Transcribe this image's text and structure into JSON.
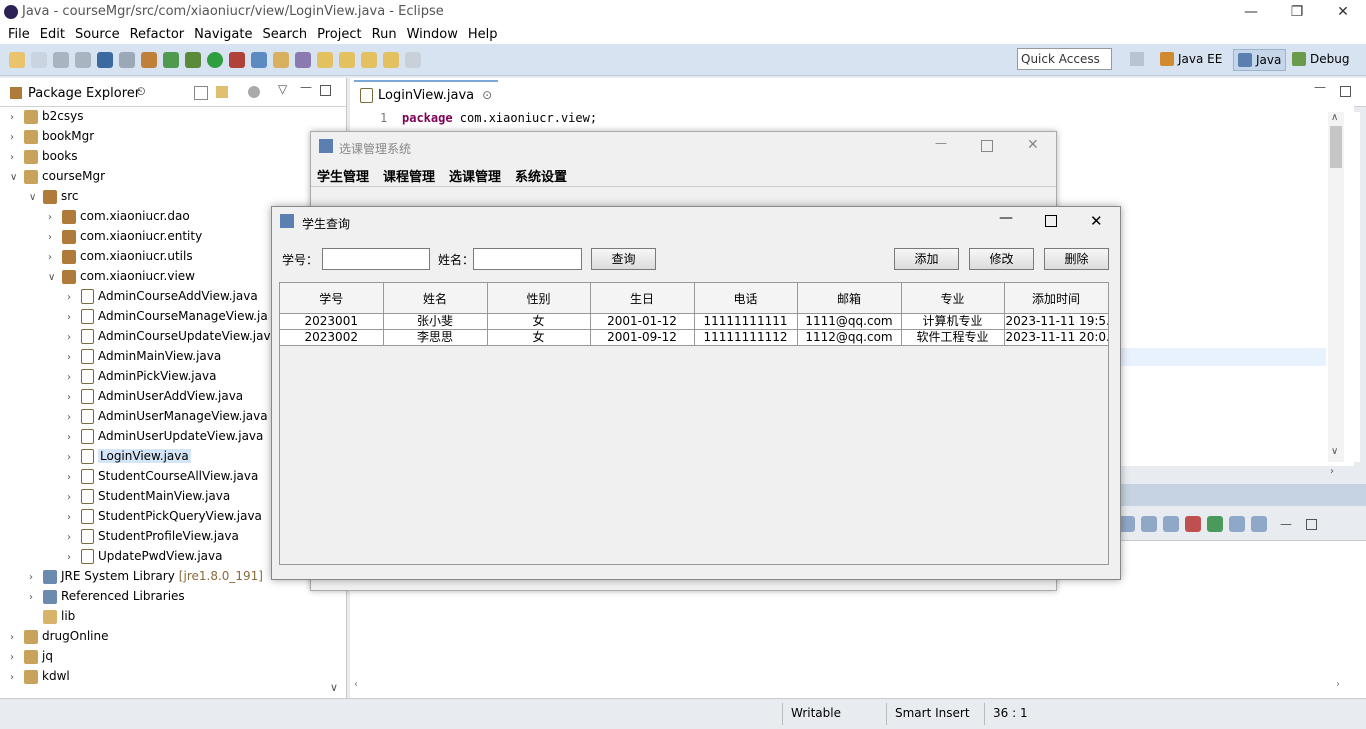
{
  "window": {
    "title": "Java - courseMgr/src/com/xiaoniucr/view/LoginView.java - Eclipse"
  },
  "menu": [
    "File",
    "Edit",
    "Source",
    "Refactor",
    "Navigate",
    "Search",
    "Project",
    "Run",
    "Window",
    "Help"
  ],
  "toolbar": {
    "quick_access": "Quick Access",
    "perspectives": [
      "Java EE",
      "Java",
      "Debug"
    ]
  },
  "package_explorer": {
    "title": "Package Explorer",
    "items": [
      {
        "label": "b2csys",
        "indent": 0,
        "icon": "project",
        "twisty": ">"
      },
      {
        "label": "bookMgr",
        "indent": 0,
        "icon": "project",
        "twisty": ">"
      },
      {
        "label": "books",
        "indent": 0,
        "icon": "project",
        "twisty": ">"
      },
      {
        "label": "courseMgr",
        "indent": 0,
        "icon": "project",
        "twisty": "v"
      },
      {
        "label": "src",
        "indent": 1,
        "icon": "pkg",
        "twisty": "v"
      },
      {
        "label": "com.xiaoniucr.dao",
        "indent": 2,
        "icon": "pkg",
        "twisty": ">"
      },
      {
        "label": "com.xiaoniucr.entity",
        "indent": 2,
        "icon": "pkg",
        "twisty": ">"
      },
      {
        "label": "com.xiaoniucr.utils",
        "indent": 2,
        "icon": "pkg",
        "twisty": ">"
      },
      {
        "label": "com.xiaoniucr.view",
        "indent": 2,
        "icon": "pkg",
        "twisty": "v"
      },
      {
        "label": "AdminCourseAddView.java",
        "indent": 3,
        "icon": "java",
        "twisty": ">"
      },
      {
        "label": "AdminCourseManageView.ja",
        "indent": 3,
        "icon": "java",
        "twisty": ">"
      },
      {
        "label": "AdminCourseUpdateView.jav",
        "indent": 3,
        "icon": "java",
        "twisty": ">"
      },
      {
        "label": "AdminMainView.java",
        "indent": 3,
        "icon": "java",
        "twisty": ">"
      },
      {
        "label": "AdminPickView.java",
        "indent": 3,
        "icon": "java",
        "twisty": ">"
      },
      {
        "label": "AdminUserAddView.java",
        "indent": 3,
        "icon": "java",
        "twisty": ">"
      },
      {
        "label": "AdminUserManageView.java",
        "indent": 3,
        "icon": "java",
        "twisty": ">"
      },
      {
        "label": "AdminUserUpdateView.java",
        "indent": 3,
        "icon": "java",
        "twisty": ">"
      },
      {
        "label": "LoginView.java",
        "indent": 3,
        "icon": "java",
        "twisty": ">",
        "selected": true
      },
      {
        "label": "StudentCourseAllView.java",
        "indent": 3,
        "icon": "java",
        "twisty": ">"
      },
      {
        "label": "StudentMainView.java",
        "indent": 3,
        "icon": "java",
        "twisty": ">"
      },
      {
        "label": "StudentPickQueryView.java",
        "indent": 3,
        "icon": "java",
        "twisty": ">"
      },
      {
        "label": "StudentProfileView.java",
        "indent": 3,
        "icon": "java",
        "twisty": ">"
      },
      {
        "label": "UpdatePwdView.java",
        "indent": 3,
        "icon": "java",
        "twisty": ">"
      },
      {
        "label": "JRE System Library",
        "indent": 1,
        "icon": "jre",
        "twisty": ">",
        "suffix": "[jre1.8.0_191]"
      },
      {
        "label": "Referenced Libraries",
        "indent": 1,
        "icon": "jre",
        "twisty": ">"
      },
      {
        "label": "lib",
        "indent": 1,
        "icon": "lib",
        "twisty": ""
      },
      {
        "label": "drugOnline",
        "indent": 0,
        "icon": "project",
        "twisty": ">"
      },
      {
        "label": "jq",
        "indent": 0,
        "icon": "project",
        "twisty": ">"
      },
      {
        "label": "kdwl",
        "indent": 0,
        "icon": "project",
        "twisty": ">"
      }
    ]
  },
  "editor": {
    "tab": "LoginView.java",
    "line_no": "1",
    "keyword": "package",
    "code": " com.xiaoniucr.view;"
  },
  "status": {
    "writable": "Writable",
    "insert": "Smart Insert",
    "position": "36 : 1"
  },
  "main_window": {
    "title": "选课管理系统",
    "menu": [
      "学生管理",
      "课程管理",
      "选课管理",
      "系统设置"
    ]
  },
  "dialog": {
    "title": "学生查询",
    "id_label": "学号：",
    "name_label": "姓名：",
    "id_value": "",
    "name_value": "",
    "query_btn": "查询",
    "add_btn": "添加",
    "edit_btn": "修改",
    "delete_btn": "删除",
    "columns": [
      "学号",
      "姓名",
      "性别",
      "生日",
      "电话",
      "邮箱",
      "专业",
      "添加时间"
    ],
    "rows": [
      [
        "2023001",
        "张小斐",
        "女",
        "2001-01-12",
        "11111111111",
        "1111@qq.com",
        "计算机专业",
        "2023-11-11 19:5..."
      ],
      [
        "2023002",
        "李思思",
        "女",
        "2001-09-12",
        "11111111112",
        "1112@qq.com",
        "软件工程专业",
        "2023-11-11 20:0..."
      ]
    ]
  }
}
